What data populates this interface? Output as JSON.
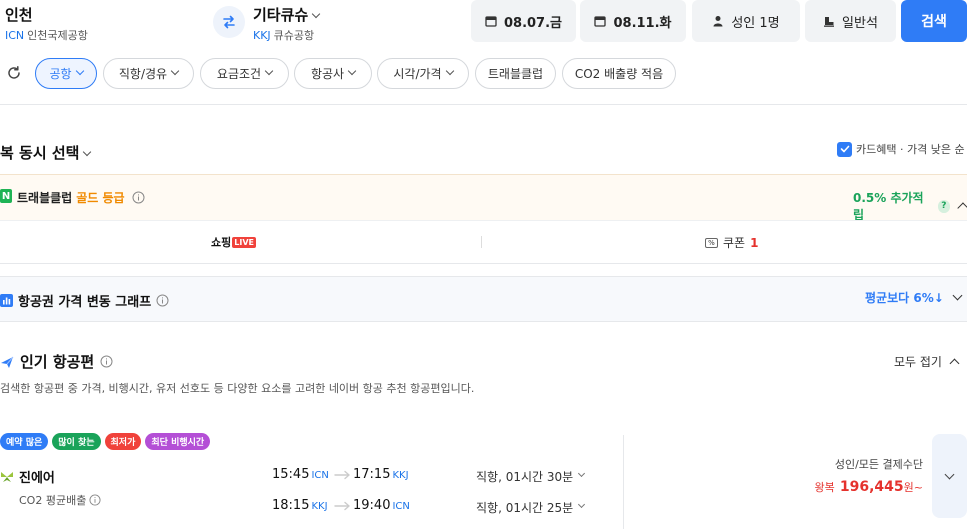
{
  "origin": {
    "name": "인천",
    "code": "ICN",
    "airport": "인천국제공항"
  },
  "destination": {
    "name": "기타큐슈",
    "code": "KKJ",
    "airport": "큐슈공항"
  },
  "dates": {
    "depart": "08.07.금",
    "return": "08.11.화"
  },
  "passengers": "성인 1명",
  "seat_class": "일반석",
  "search_label": "검색",
  "filters": [
    {
      "label": "공항",
      "dropdown": true,
      "active": true
    },
    {
      "label": "직항/경유",
      "dropdown": true
    },
    {
      "label": "요금조건",
      "dropdown": true
    },
    {
      "label": "항공사",
      "dropdown": true
    },
    {
      "label": "시각/가격",
      "dropdown": true
    },
    {
      "label": "트래블클럽",
      "dropdown": false
    },
    {
      "label": "CO2 배출량 적음",
      "dropdown": false
    }
  ],
  "roundtrip_select": {
    "title": "복 동시 선택",
    "sort_label": "카드혜택 · 가격 낮은 순"
  },
  "travelclub": {
    "label": "트래블클럽",
    "grade": "골드 등급",
    "benefit": "0.5% 추가적립",
    "shopping_label": "쇼핑",
    "live_badge": "LIVE",
    "coupon_label": "쿠폰",
    "coupon_count": "1"
  },
  "price_graph": {
    "title": "항공권 가격 변동 그래프",
    "compare": "평균보다 6%↓"
  },
  "popular": {
    "title": "인기 항공편",
    "collapse_label": "모두 접기",
    "description": "검색한 항공편 중 가격, 비행시간, 유저 선호도 등 다양한 요소를 고려한 네이버 항공 추천 항공편입니다."
  },
  "flight_card": {
    "tags": [
      {
        "label": "예약 많은",
        "color": "#2f7cf6"
      },
      {
        "label": "많이 찾는",
        "color": "#1aa35a"
      },
      {
        "label": "최저가",
        "color": "#f0423b"
      },
      {
        "label": "최단 비행시간",
        "color": "#b44fd6"
      }
    ],
    "airline": "진에어",
    "co2": "CO2 평균배출",
    "outbound": {
      "dep_time": "15:45",
      "dep_code": "ICN",
      "arr_time": "17:15",
      "arr_code": "KKJ",
      "info": "직항, 01시간 30분"
    },
    "inbound": {
      "dep_time": "18:15",
      "dep_code": "KKJ",
      "arr_time": "19:40",
      "arr_code": "ICN",
      "info": "직항, 01시간 25분"
    },
    "price_note": "성인/모든 결제수단",
    "price_prefix": "왕복",
    "price": "196,445",
    "price_unit": "원~"
  },
  "colors": {
    "accent": "#2f7cf6",
    "price_red": "#e5322d",
    "green": "#1aa35a",
    "orange": "#f08a00"
  }
}
